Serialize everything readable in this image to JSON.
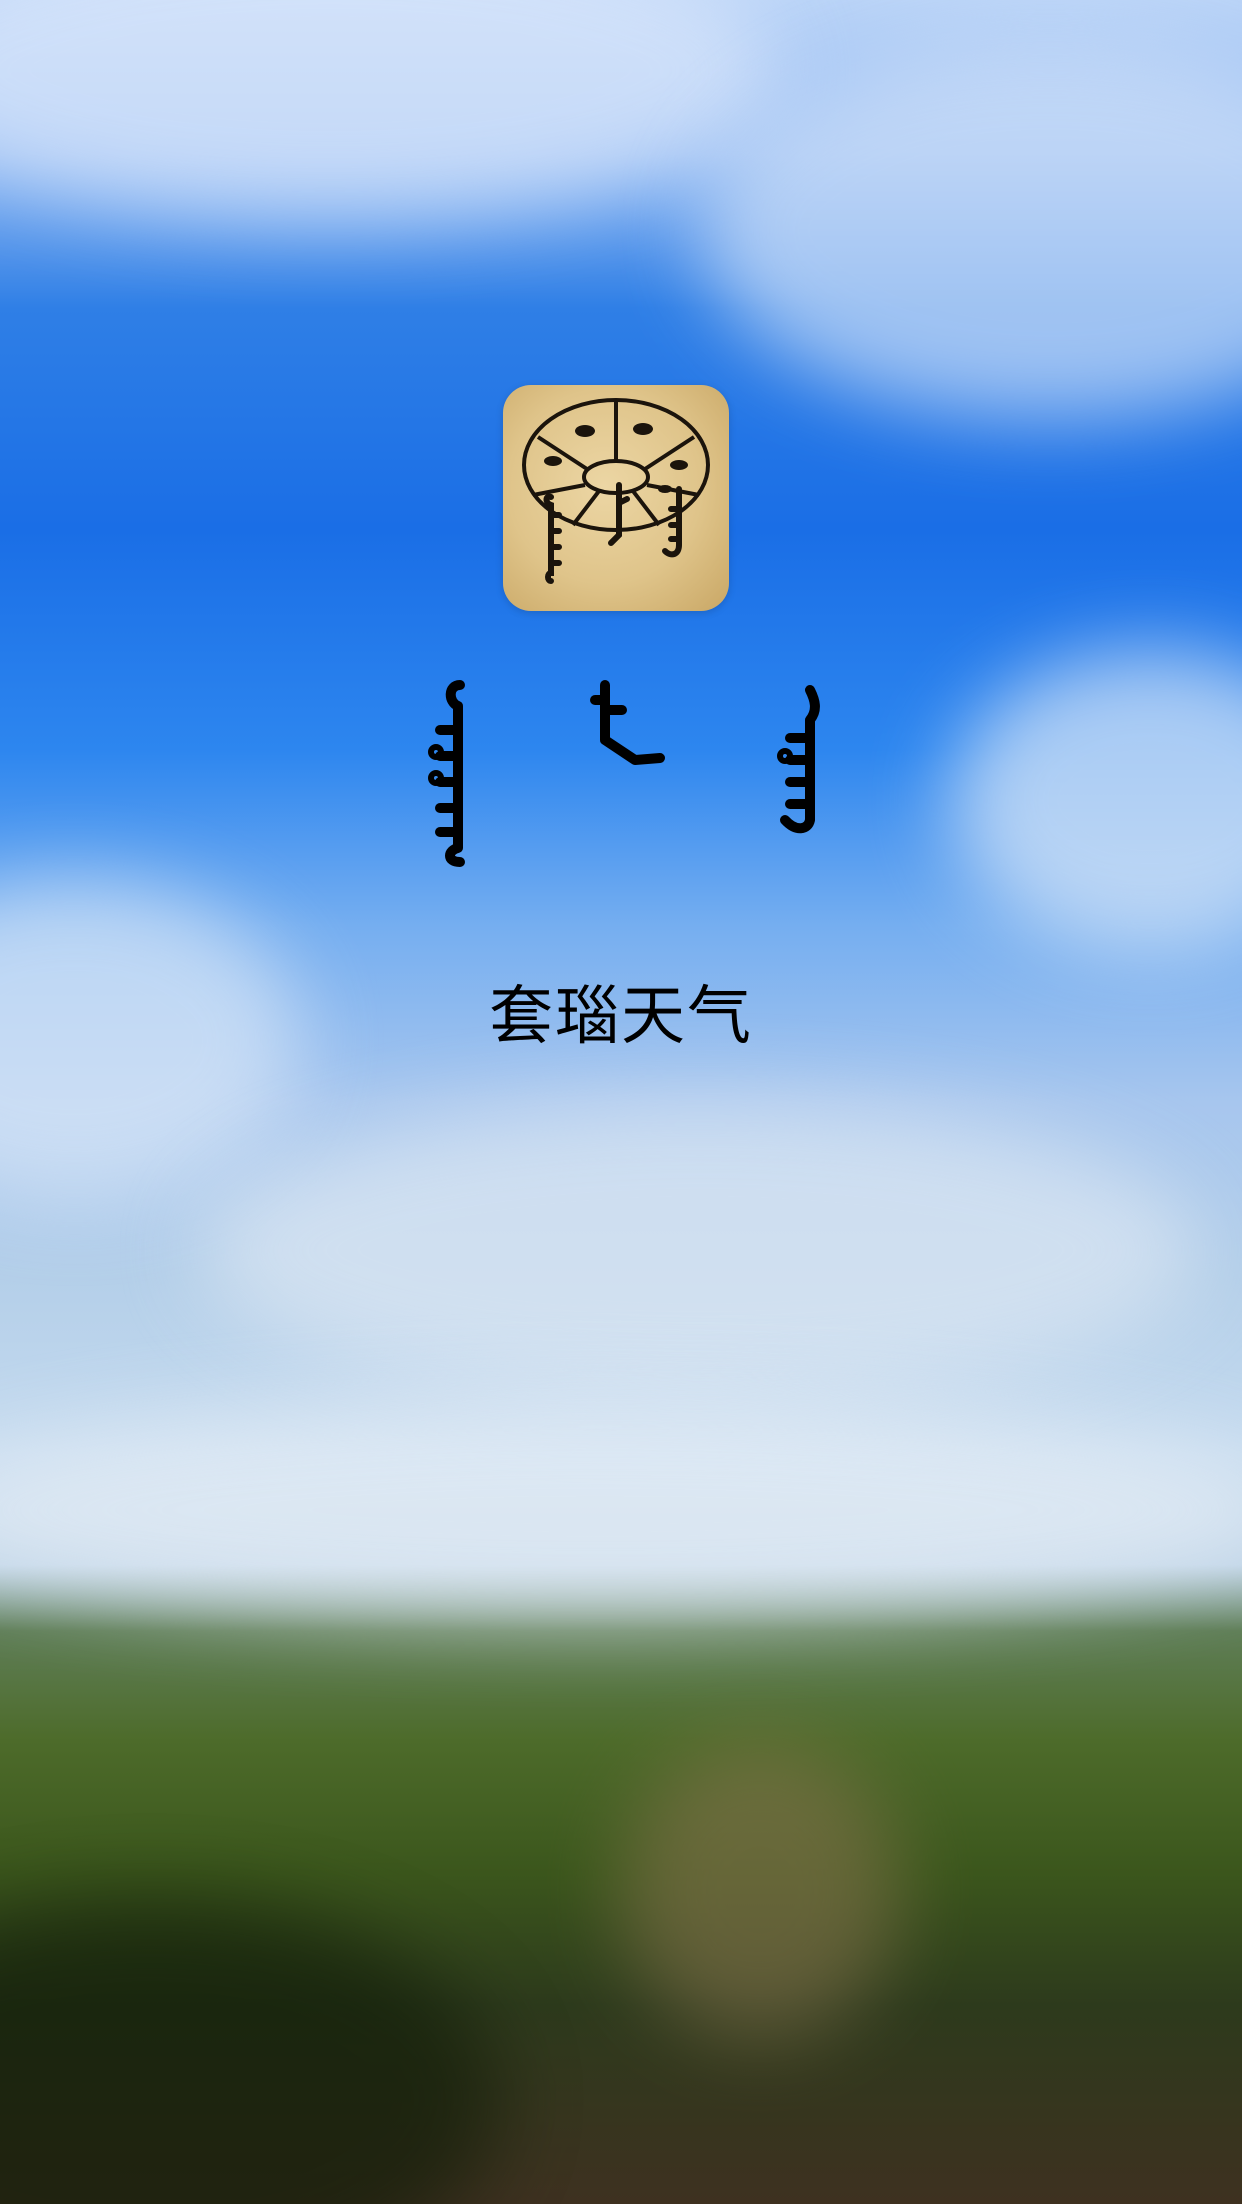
{
  "app_title_chinese": "套瑙天气",
  "app_icon": {
    "name": "weather-wheel-icon",
    "background": "#dfc48a",
    "ink": "#1b140c"
  },
  "colors": {
    "text": "#000000",
    "sky": "#1a6ee6",
    "grass": "#4d6b2a"
  }
}
